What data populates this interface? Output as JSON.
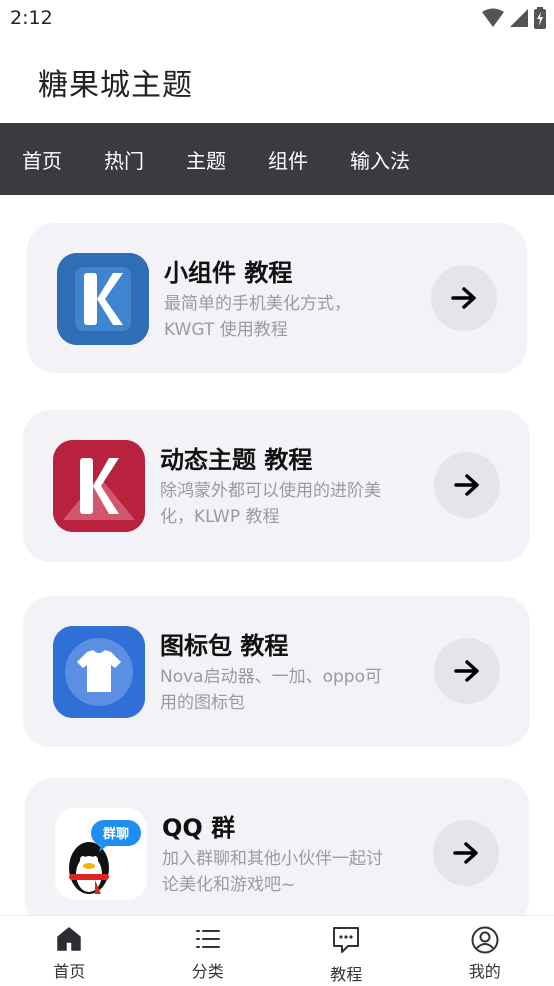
{
  "status_bar": {
    "time": "2:12"
  },
  "app": {
    "title": "糖果城主题"
  },
  "top_tabs": [
    {
      "label": "首页"
    },
    {
      "label": "热门"
    },
    {
      "label": "主题"
    },
    {
      "label": "组件"
    },
    {
      "label": "输入法"
    }
  ],
  "cards": [
    {
      "title": "小组件 教程",
      "desc": "最简单的手机美化方式，KWGT 使用教程",
      "icon": "kwgt-app-icon",
      "icon_color": "#2f6db5"
    },
    {
      "title": "动态主题 教程",
      "desc": "除鸿蒙外都可以使用的进阶美化，KLWP 教程",
      "icon": "klwp-app-icon",
      "icon_color": "#b8223f"
    },
    {
      "title": "图标包 教程",
      "desc": "Nova启动器、一加、oppo可用的图标包",
      "icon": "icon-pack-app-icon",
      "icon_color": "#2f6fd6"
    },
    {
      "title": "QQ 群",
      "desc": "加入群聊和其他小伙伴一起讨论美化和游戏吧~",
      "icon": "qq-group-icon",
      "icon_color": "#ffffff",
      "badge": "群聊"
    }
  ],
  "bottom_nav": [
    {
      "label": "首页",
      "icon": "home-icon",
      "active": true
    },
    {
      "label": "分类",
      "icon": "list-icon",
      "active": false
    },
    {
      "label": "教程",
      "icon": "chat-icon",
      "active": false
    },
    {
      "label": "我的",
      "icon": "profile-icon",
      "active": false
    }
  ]
}
